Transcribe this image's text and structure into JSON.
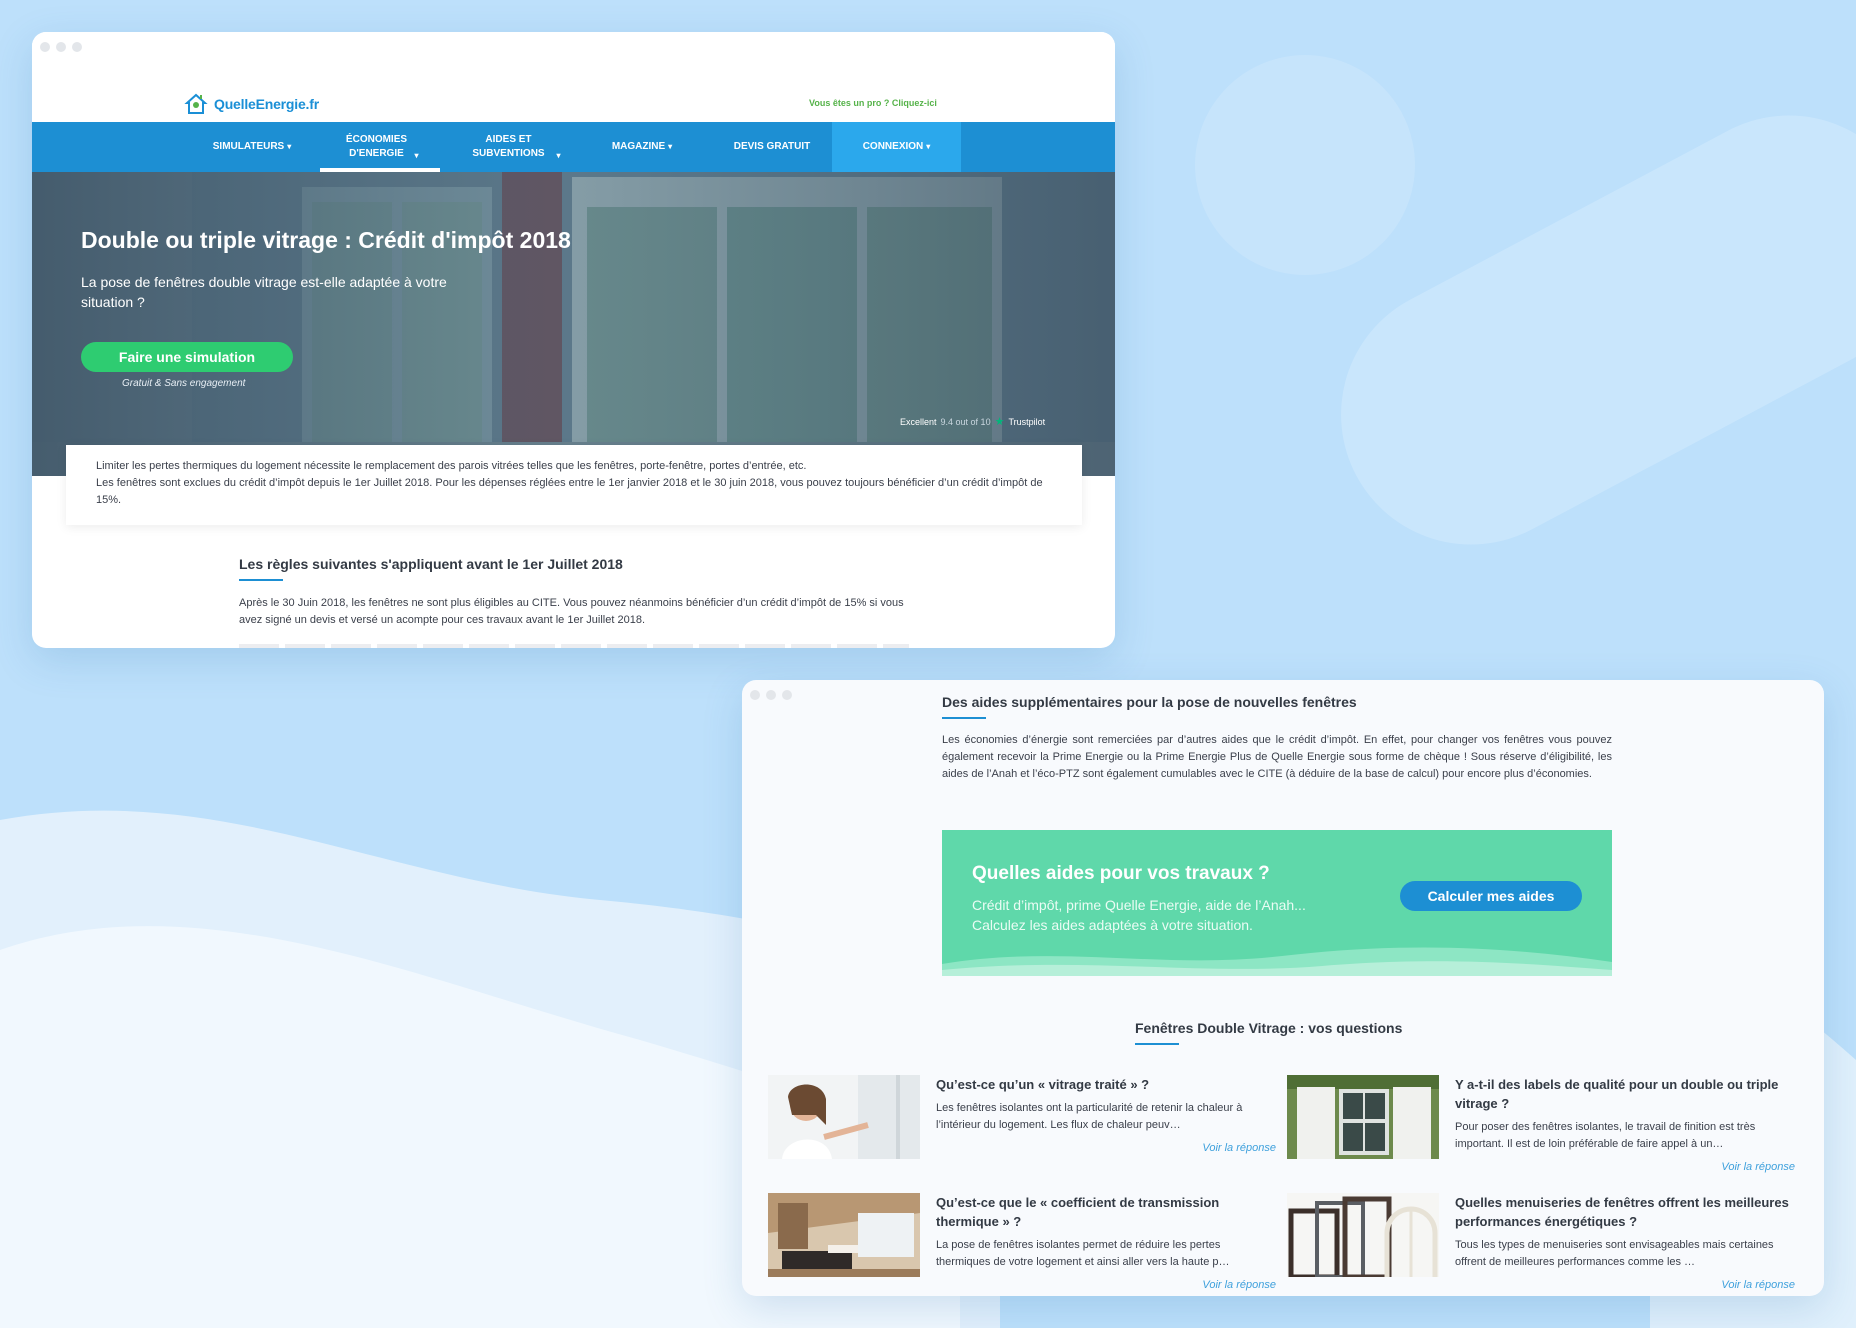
{
  "window1": {
    "logo_text": "QuelleEnergie.fr",
    "pro_link": "Vous êtes un pro ? Cliquez-ici",
    "nav": [
      {
        "label": "SIMULATEURS"
      },
      {
        "label": "ÉCONOMIES D'ENERGIE"
      },
      {
        "label": "AIDES ET SUBVENTIONS"
      },
      {
        "label": "MAGAZINE"
      },
      {
        "label": "DEVIS GRATUIT"
      },
      {
        "label": "CONNEXION"
      }
    ],
    "hero": {
      "title": "Double ou triple vitrage : Crédit d'impôt 2018",
      "subtitle": "La pose de fenêtres double vitrage est-elle adaptée à votre situation ?",
      "button": "Faire une simulation",
      "button_note": "Gratuit & Sans engagement",
      "trust_label": "Excellent",
      "trust_score": "9.4 out of 10",
      "trust_brand": "Trustpilot"
    },
    "intro": {
      "line1": "Limiter les pertes thermiques du logement nécessite le remplacement des parois vitrées telles que les fenêtres, porte-fenêtre, portes d’entrée, etc.",
      "line2": "Les fenêtres sont exclues du crédit d’impôt depuis le 1er Juillet 2018. Pour les dépenses réglées entre le 1er janvier 2018 et le 30 juin 2018, vous pouvez toujours bénéficier d’un crédit d’impôt de 15%."
    },
    "rules": {
      "title": "Les règles suivantes s'appliquent avant le 1er Juillet 2018",
      "text": "Après le 30 Juin 2018, les fenêtres ne sont plus éligibles au CITE. Vous pouvez néanmoins bénéficier d’un crédit d’impôt de 15% si vous avez signé un devis et versé un acompte pour ces travaux avant le 1er Juillet 2018."
    }
  },
  "window2": {
    "title": "Des aides supplémentaires pour la pose de nouvelles fenêtres",
    "text": "Les économies d’énergie sont remerciées par d’autres aides que le crédit d’impôt. En effet, pour changer vos fenêtres vous pouvez également recevoir la Prime Energie ou la Prime Energie Plus de Quelle Energie sous forme de chèque ! Sous réserve d’éligibilité, les aides de l’Anah et l’éco-PTZ sont également cumulables avec le CITE (à déduire de la base de calcul) pour encore plus d’économies.",
    "cta": {
      "title": "Quelles aides pour vos travaux ?",
      "line1": "Crédit d’impôt, prime Quelle Energie, aide de l’Anah...",
      "line2": "Calculez les aides adaptées à votre situation.",
      "button": "Calculer mes aides"
    },
    "faq_title": "Fenêtres Double Vitrage : vos questions",
    "faq": [
      {
        "question": "Qu’est-ce qu’un « vitrage traité » ?",
        "answer": "Les fenêtres isolantes ont la particularité de retenir la chaleur à l’intérieur du logement. Les flux de chaleur peuv…",
        "link": "Voir la réponse"
      },
      {
        "question": "Y a-t-il des labels de qualité pour un double ou triple vitrage ?",
        "answer": "Pour poser des fenêtres isolantes, le travail de finition est très important. Il est de loin préférable de faire appel à un…",
        "link": "Voir la réponse"
      },
      {
        "question": "Qu’est-ce que le « coefficient de transmission thermique » ?",
        "answer": "La pose de fenêtres isolantes permet de réduire les pertes thermiques de votre logement et ainsi aller vers la haute p…",
        "link": "Voir la réponse"
      },
      {
        "question": "Quelles menuiseries de fenêtres offrent les meilleures performances énergétiques ?",
        "answer": "Tous les types de menuiseries sont envisageables mais certaines offrent de meilleures performances comme les …",
        "link": "Voir la réponse"
      }
    ]
  },
  "colors": {
    "background": "#bde0fb",
    "nav_blue": "#1d8fd3",
    "cta_green": "#5fd8aa",
    "button_green": "#2ecc71"
  }
}
